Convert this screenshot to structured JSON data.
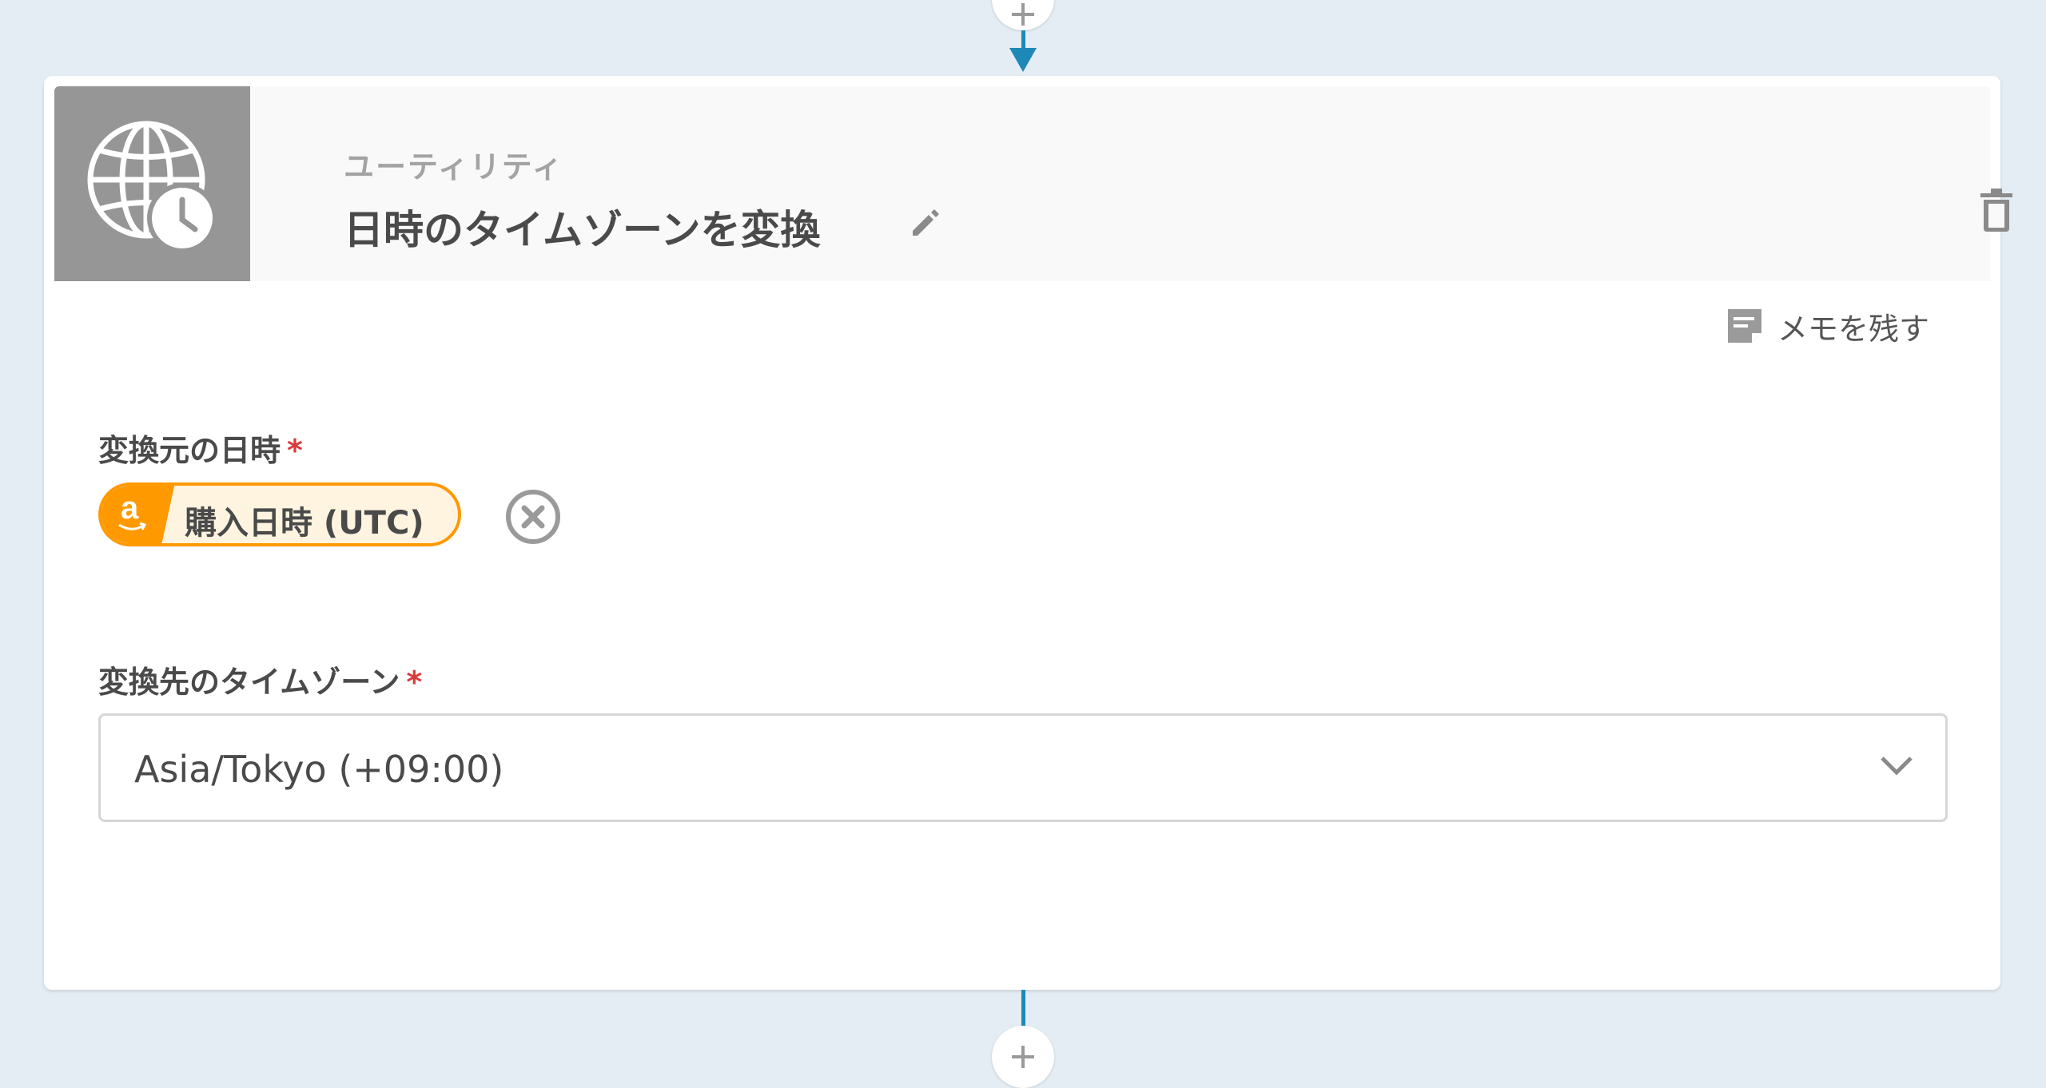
{
  "step": {
    "category": "ユーティリティ",
    "title": "日時のタイムゾーンを変換",
    "memo_label": "メモを残す"
  },
  "fields": {
    "source_datetime": {
      "label": "変換元の日時",
      "required_mark": "*",
      "token": {
        "icon_letter": "a",
        "label": "購入日時 (UTC)",
        "color": "#ff9900"
      }
    },
    "target_timezone": {
      "label": "変換先のタイムゾーン",
      "required_mark": "*",
      "selected_value": "Asia/Tokyo (+09:00)"
    }
  },
  "icons": {
    "top_add": "plus-icon",
    "app": "globe-clock-icon",
    "status": "check-icon",
    "edit": "pencil-icon",
    "delete": "trash-icon",
    "memo": "note-icon",
    "clear": "close-circle-icon",
    "dropdown": "chevron-down-icon"
  },
  "colors": {
    "background": "#e4edf3",
    "connector": "#1e88b8",
    "token_accent": "#ff9900",
    "required": "#d93a3a"
  }
}
